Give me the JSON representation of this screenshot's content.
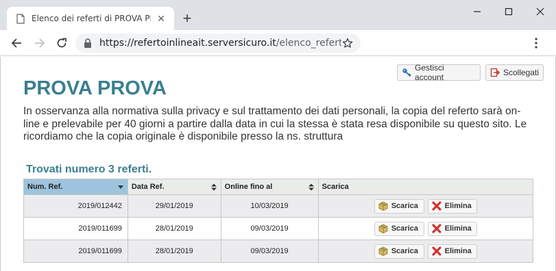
{
  "browser": {
    "tab_title": "Elenco dei referti di PROVA PROVA",
    "tab_close_glyph": "✕",
    "new_tab_glyph": "+",
    "url_host": "https://refertoinlineait.serversicuro.it",
    "url_path": "/elenco_referti.php"
  },
  "header": {
    "manage_account_label": "Gestisci account",
    "logout_label": "Scollegati"
  },
  "main": {
    "patient_name": "PROVA PROVA",
    "privacy_notice": "In osservanza alla normativa sulla privacy e sul trattamento dei dati personali, la copia del referto sarà on-line e prelevabile per 40 giorni a partire dalla data in cui la stessa è stata resa disponibile su questo sito. Le ricordiamo che la copia originale è disponibile presso la ns. struttura",
    "results_count": "Trovati numero 3 referti."
  },
  "table": {
    "columns": [
      "Num. Ref.",
      "Data Ref.",
      "Online fino al",
      "Scarica"
    ],
    "download_label": "Scarica",
    "delete_label": "Elimina",
    "rows": [
      {
        "num": "2019/012442",
        "date": "29/01/2019",
        "online_until": "10/03/2019"
      },
      {
        "num": "2019/011699",
        "date": "28/01/2019",
        "online_until": "09/03/2019"
      },
      {
        "num": "2019/011699",
        "date": "28/01/2019",
        "online_until": "09/03/2019"
      }
    ]
  },
  "colors": {
    "title_teal": "#3a7f90",
    "sorted_header": "#9ec4dd",
    "delete_icon_red": "#d32f2f",
    "download_icon_tan": "#c9a44a"
  }
}
